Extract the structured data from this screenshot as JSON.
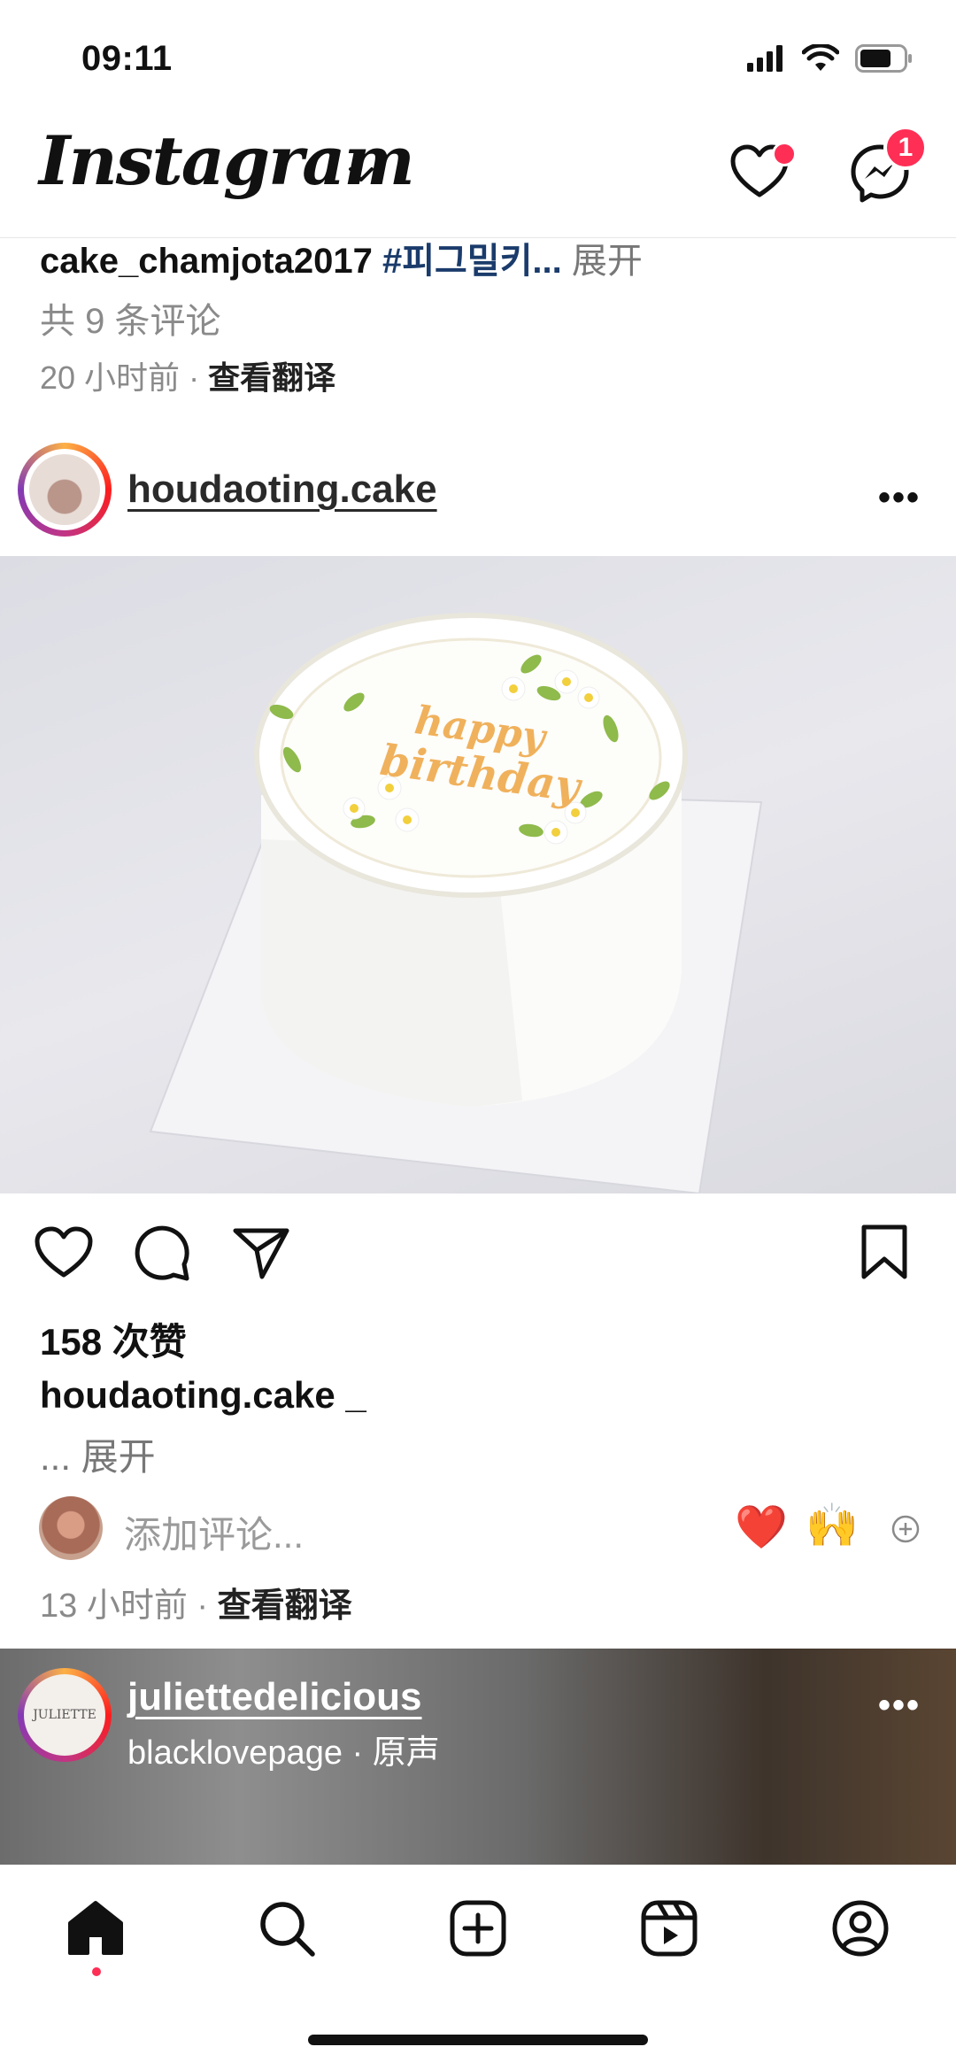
{
  "status_bar": {
    "time": "09:11"
  },
  "header": {
    "logo": "Instagram",
    "notification_count": "1"
  },
  "prev_post": {
    "username": "cake_chamjota2017",
    "hashtag": "#피그밀키...",
    "expand": "展开",
    "comments": "共 9 条评论",
    "time": "20 小时前",
    "separator": "·",
    "translate": "查看翻译"
  },
  "post": {
    "username": "houdaoting.cake",
    "cake_text_line1": "happy",
    "cake_text_line2": "birthday",
    "likes": "158 次赞",
    "caption_user": "houdaoting.cake _",
    "caption_more": "... 展开",
    "comment_placeholder": "添加评论...",
    "quick_reaction_1": "❤️",
    "quick_reaction_2": "🙌",
    "time": "13 小时前",
    "separator": "·",
    "translate": "查看翻译"
  },
  "reel": {
    "username": "juliettedelicious",
    "avatar_text": "JULIETTE",
    "audio": "blacklovepage · 原声"
  },
  "icons": {
    "heart": "heart-icon",
    "messenger": "messenger-icon",
    "comment": "comment-icon",
    "share": "share-icon",
    "bookmark": "bookmark-icon",
    "home": "home-icon",
    "search": "search-icon",
    "create": "plus-square-icon",
    "reels": "reels-icon",
    "profile": "profile-icon"
  },
  "colors": {
    "accent": "#ff2e55",
    "hashtag": "#1a3b6b"
  }
}
